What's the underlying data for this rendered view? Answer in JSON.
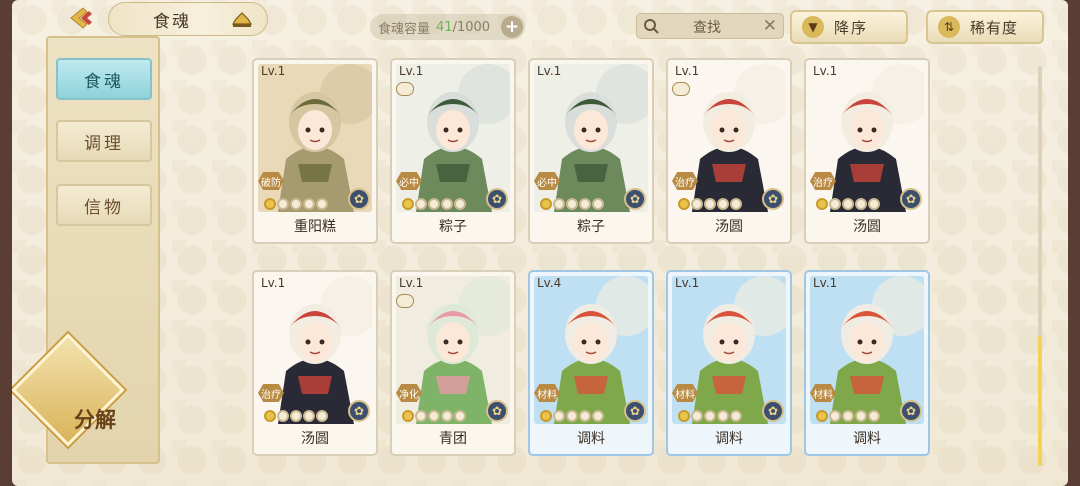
{
  "header": {
    "title": "食魂",
    "capacity_label": "食魂容量",
    "capacity_current": "41",
    "capacity_max": "/1000",
    "capacity_add": "+",
    "search_placeholder": "查找",
    "search_clear": "✕",
    "sort_order_label": "降序",
    "sort_rarity_label": "稀有度"
  },
  "sidebar": {
    "tabs": [
      {
        "label": "食魂",
        "active": true
      },
      {
        "label": "调理",
        "active": false
      },
      {
        "label": "信物",
        "active": false
      }
    ],
    "decompose_label": "分解"
  },
  "cards": [
    {
      "level": "Lv.1",
      "name": "重阳糕",
      "role": "破防",
      "stars_on": 1,
      "stars_total": 5,
      "badge": false,
      "blue": false,
      "palette": [
        "#e9d9b8",
        "#d7c6a2",
        "#a69a6f",
        "#6b6b3b"
      ]
    },
    {
      "level": "Lv.1",
      "name": "粽子",
      "role": "必中",
      "stars_on": 1,
      "stars_total": 5,
      "badge": true,
      "blue": false,
      "palette": [
        "#eef0e8",
        "#d9dedb",
        "#6c8a5c",
        "#3e5a3a"
      ]
    },
    {
      "level": "Lv.1",
      "name": "粽子",
      "role": "必中",
      "stars_on": 1,
      "stars_total": 5,
      "badge": false,
      "blue": false,
      "palette": [
        "#eef0e8",
        "#d9dedb",
        "#6c8a5c",
        "#3e5a3a"
      ]
    },
    {
      "level": "Lv.1",
      "name": "汤圆",
      "role": "治疗",
      "stars_on": 1,
      "stars_total": 5,
      "badge": true,
      "blue": false,
      "palette": [
        "#fbf7f0",
        "#f3ece1",
        "#2a2a36",
        "#c9443a"
      ]
    },
    {
      "level": "Lv.1",
      "name": "汤圆",
      "role": "治疗",
      "stars_on": 1,
      "stars_total": 5,
      "badge": false,
      "blue": false,
      "palette": [
        "#fbf7f0",
        "#f3ece1",
        "#2a2a36",
        "#c9443a"
      ]
    },
    {
      "level": "Lv.1",
      "name": "汤圆",
      "role": "治疗",
      "stars_on": 1,
      "stars_total": 5,
      "badge": false,
      "blue": false,
      "palette": [
        "#fbf7f0",
        "#f3ece1",
        "#2a2a36",
        "#c9443a"
      ]
    },
    {
      "level": "Lv.1",
      "name": "青团",
      "role": "净化",
      "stars_on": 1,
      "stars_total": 5,
      "badge": true,
      "blue": false,
      "palette": [
        "#f1ece0",
        "#dfe9d8",
        "#7fb368",
        "#e89aa5"
      ]
    },
    {
      "level": "Lv.4",
      "name": "调料",
      "role": "材料",
      "stars_on": 1,
      "stars_total": 5,
      "badge": false,
      "blue": true,
      "palette": [
        "#bfe0f2",
        "#f0ece3",
        "#7fa84a",
        "#d8543a"
      ]
    },
    {
      "level": "Lv.1",
      "name": "调料",
      "role": "材料",
      "stars_on": 1,
      "stars_total": 5,
      "badge": false,
      "blue": true,
      "palette": [
        "#bfe0f2",
        "#f0ece3",
        "#7fa84a",
        "#d8543a"
      ]
    },
    {
      "level": "Lv.1",
      "name": "调料",
      "role": "材料",
      "stars_on": 1,
      "stars_total": 5,
      "badge": false,
      "blue": true,
      "palette": [
        "#bfe0f2",
        "#f0ece3",
        "#7fa84a",
        "#d8543a"
      ]
    }
  ],
  "icons": {
    "back": "chevron-left-icon",
    "hat": "hat-icon",
    "search": "search-icon",
    "sort_order": "triangle-down-icon",
    "sort_rarity": "sort-icon",
    "element": "flower-element-icon"
  },
  "colors": {
    "active_tab": "#8fd2da",
    "gold": "#d9b45a",
    "capacity_current": "#6fb35a"
  }
}
